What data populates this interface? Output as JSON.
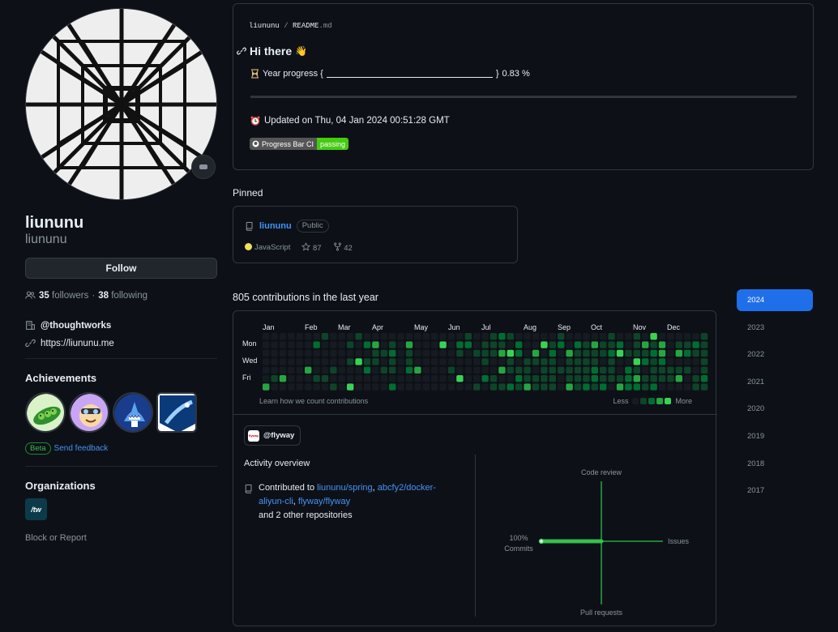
{
  "profile": {
    "name": "liununu",
    "login": "liununu",
    "follow_label": "Follow",
    "followers_count": "35",
    "followers_label": "followers",
    "separator": "·",
    "following_count": "38",
    "following_label": "following",
    "company": "@thoughtworks",
    "website": "https://liununu.me"
  },
  "achievements": {
    "title": "Achievements",
    "beta_label": "Beta",
    "feedback_label": "Send feedback"
  },
  "organizations": {
    "title": "Organizations",
    "org_abbr": "/tw",
    "block_label": "Block or Report"
  },
  "readme": {
    "path_user": "liununu",
    "path_sep": "/",
    "path_file": "README",
    "path_ext": ".md",
    "heading": "Hi there",
    "heading_emoji": "👋",
    "progress_label": "Year progress {",
    "progress_close": "}",
    "progress_value": "0.83 %",
    "updated_text": "Updated on Thu, 04 Jan 2024 00:51:28 GMT",
    "ci_label": "Progress Bar CI",
    "ci_status": "passing"
  },
  "pinned": {
    "title": "Pinned",
    "repo_name": "liununu",
    "visibility": "Public",
    "language": "JavaScript",
    "stars": "87",
    "forks": "42"
  },
  "contributions": {
    "title": "805 contributions in the last year",
    "months": [
      "Jan",
      "Feb",
      "Mar",
      "Apr",
      "May",
      "Jun",
      "Jul",
      "Aug",
      "Sep",
      "Oct",
      "Nov",
      "Dec"
    ],
    "days": [
      "Mon",
      "Wed",
      "Fri"
    ],
    "learn_label": "Learn how we count contributions",
    "less_label": "Less",
    "more_label": "More",
    "levels": [
      "#161b22",
      "#0e4429",
      "#006d32",
      "#26a641",
      "#39d353"
    ]
  },
  "activity": {
    "org_chip": "@flyway",
    "org_chip_logo": "flyway",
    "title": "Activity overview",
    "contributed_prefix": "Contributed to",
    "repo1": "liununu/spring",
    "repo2": "abcfy2/docker-aliyun-cli",
    "repo3": "flyway/flyway",
    "suffix": "and 2 other repositories",
    "radar_top": "Code review",
    "radar_right": "Issues",
    "radar_bottom": "Pull requests",
    "radar_left_pct": "100%",
    "radar_left": "Commits"
  },
  "years": [
    "2024",
    "2023",
    "2022",
    "2021",
    "2020",
    "2019",
    "2018",
    "2017"
  ],
  "selected_year": "2024"
}
